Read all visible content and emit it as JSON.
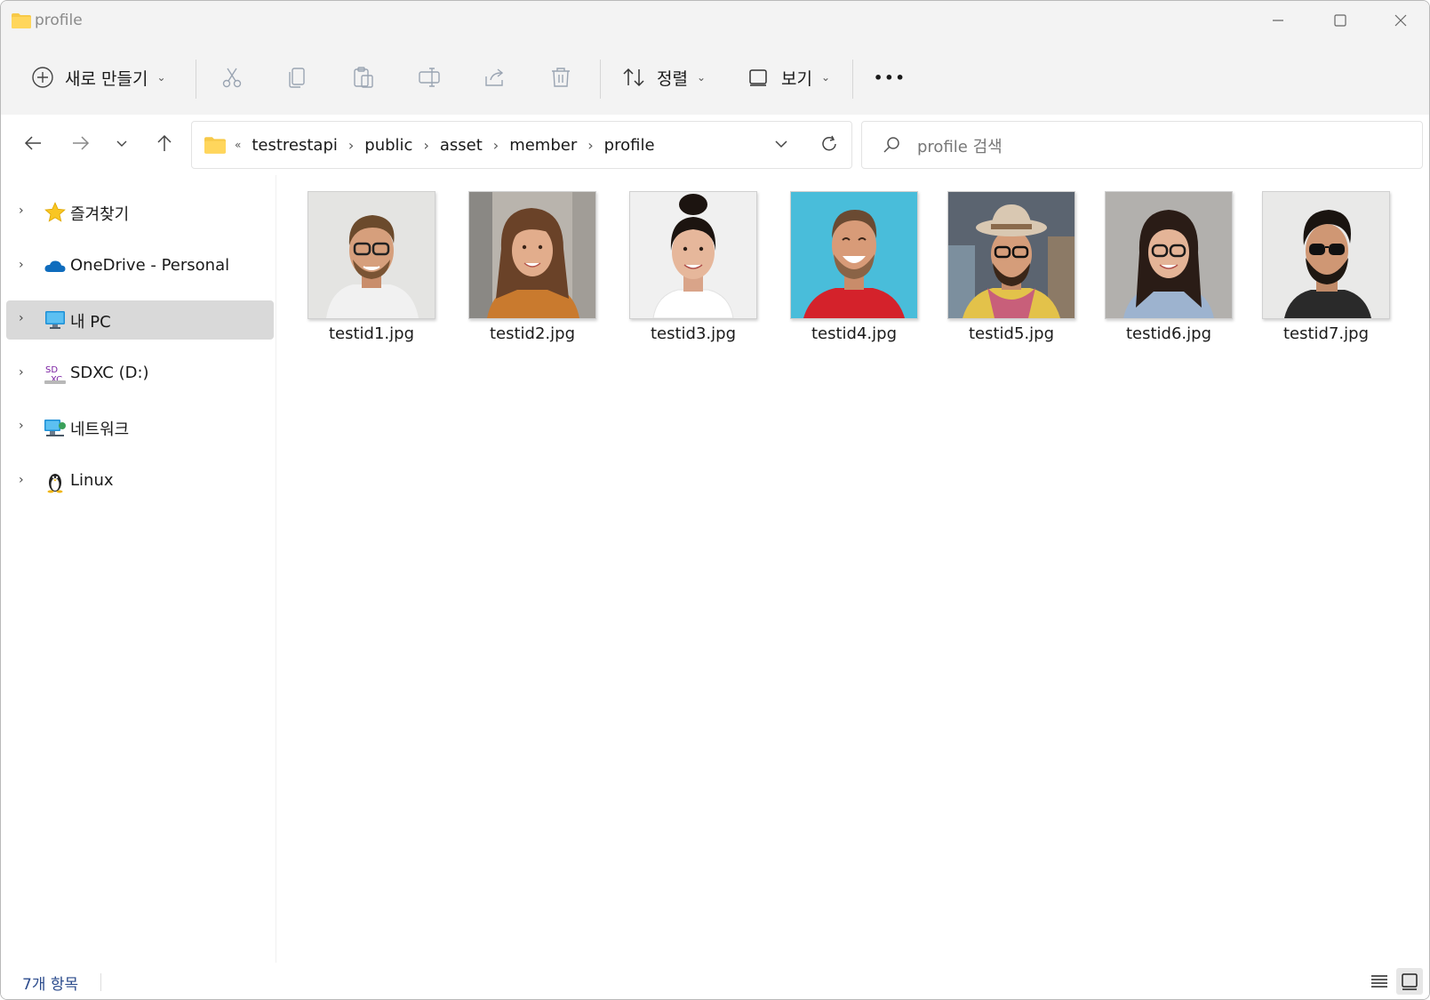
{
  "window": {
    "title": "profile",
    "controls": [
      "minimize",
      "maximize",
      "close"
    ]
  },
  "toolbar": {
    "new_label": "새로 만들기",
    "sort_label": "정렬",
    "view_label": "보기",
    "more_label": "•••",
    "tools": [
      "cut-icon",
      "copy-icon",
      "paste-icon",
      "rename-icon",
      "share-icon",
      "delete-icon"
    ]
  },
  "address": {
    "overflow": "«",
    "crumbs": [
      "testrestapi",
      "public",
      "asset",
      "member",
      "profile"
    ]
  },
  "search": {
    "placeholder": "profile 검색"
  },
  "sidebar": {
    "items": [
      {
        "label": "즐겨찾기",
        "icon": "star-icon"
      },
      {
        "label": "OneDrive - Personal",
        "icon": "cloud-icon"
      },
      {
        "label": "내 PC",
        "icon": "monitor-icon",
        "selected": true
      },
      {
        "label": "SDXC (D:)",
        "icon": "sd-card-icon"
      },
      {
        "label": "네트워크",
        "icon": "network-icon"
      },
      {
        "label": "Linux",
        "icon": "penguin-icon"
      }
    ]
  },
  "files": [
    {
      "name": "testid1.jpg"
    },
    {
      "name": "testid2.jpg"
    },
    {
      "name": "testid3.jpg"
    },
    {
      "name": "testid4.jpg"
    },
    {
      "name": "testid5.jpg"
    },
    {
      "name": "testid6.jpg"
    },
    {
      "name": "testid7.jpg"
    }
  ],
  "status": {
    "count": "7개 항목"
  },
  "colors": {
    "folder": "#f7c948",
    "selected": "#d9d9d9",
    "accent": "#0067c0"
  }
}
